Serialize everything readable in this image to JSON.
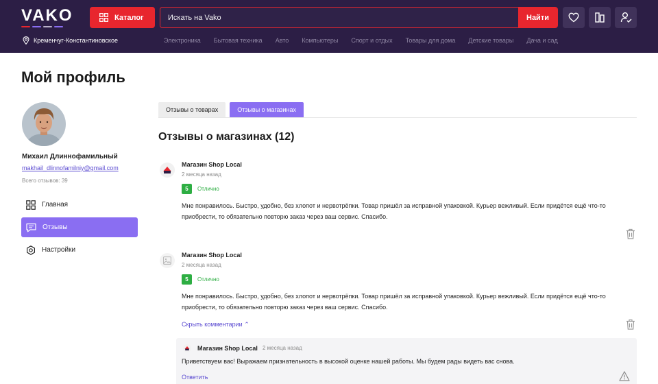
{
  "header": {
    "logo": "VAKO",
    "logo_bar_colors": [
      "#e8262e",
      "#8a6ef2",
      "#b9b1c9",
      "#8a6ef2"
    ],
    "catalog_label": "Каталог",
    "search": {
      "placeholder": "Искать на Vako",
      "button_label": "Найти"
    },
    "icons": [
      "heart-icon",
      "compare-icon",
      "user-check-icon"
    ],
    "location": "Кременчуг-Константиновское",
    "nav": [
      "Электроника",
      "Бытовая техника",
      "Авто",
      "Компьютеры",
      "Спорт и отдых",
      "Товары для дома",
      "Детские товары",
      "Дача и сад"
    ]
  },
  "page": {
    "title": "Мой профиль"
  },
  "profile": {
    "name": "Михаил Длиннофамильный",
    "email": "makhail_dlinnofamilniy@gmail.com",
    "reviews_count": "Всего отзывов: 39"
  },
  "sidebar": {
    "items": [
      {
        "label": "Главная",
        "icon": "grid-icon",
        "active": false
      },
      {
        "label": "Отзывы",
        "icon": "chat-icon",
        "active": true
      },
      {
        "label": "Настройки",
        "icon": "settings-icon",
        "active": false
      }
    ]
  },
  "tabs": [
    {
      "label": "Отзывы о товарах",
      "active": false
    },
    {
      "label": "Отзывы о магазинах",
      "active": true
    }
  ],
  "section_title": "Отзывы о магазинах (12)",
  "reviews": [
    {
      "shop": "Магазин Shop Local",
      "date": "2 месяца назад",
      "rating": "5",
      "rating_label": "Отлично",
      "text": "Мне понравилось. Быстро, удобно, без хлопот и нервотрёпки. Товар пришёл за исправной упаковкой. Курьер вежливый. Если придётся ещё что-то приобрести, то обязательно повторю заказ через ваш сервис. Спасибо."
    },
    {
      "shop": "Магазин Shop Local",
      "date": "2 месяца назад",
      "rating": "5",
      "rating_label": "Отлично",
      "text": "Мне понравилось. Быстро, удобно, без хлопот и нервотрёпки. Товар пришёл за исправной упаковкой. Курьер вежливый. Если придётся ещё что-то приобрести, то обязательно повторю заказ через ваш сервис. Спасибо.",
      "toggle_comments": "Скрыть комментарии ⌃"
    }
  ],
  "reply": {
    "shop": "Магазин Shop Local",
    "date": "2 месяца назад",
    "text": "Приветствуем вас! Выражаем признательность в высокой оценке нашей работы. Мы будем рады видеть вас снова.",
    "reply_label": "Ответить"
  },
  "colors": {
    "header_bg": "#2c1e45",
    "accent_red": "#e8262e",
    "accent_purple": "#8a6ef2",
    "link": "#5b4bd1",
    "rating_green": "#2eae43"
  }
}
